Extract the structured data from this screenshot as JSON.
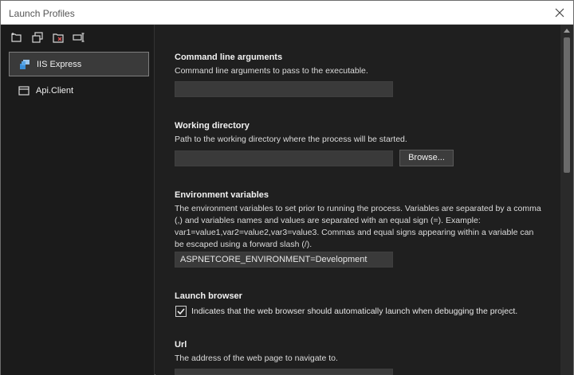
{
  "window": {
    "title": "Launch Profiles"
  },
  "toolbar": {
    "icons": [
      "new-profile-icon",
      "copy-profile-icon",
      "delete-profile-icon",
      "rename-profile-icon"
    ]
  },
  "profiles": [
    {
      "label": "IIS Express",
      "icon": "iis-express-icon",
      "selected": true
    },
    {
      "label": "Api.Client",
      "icon": "project-window-icon",
      "selected": false
    }
  ],
  "command_line": {
    "heading": "Command line arguments",
    "description": "Command line arguments to pass to the executable.",
    "value": ""
  },
  "working_directory": {
    "heading": "Working directory",
    "description": "Path to the working directory where the process will be started.",
    "value": "",
    "browse_label": "Browse..."
  },
  "env_vars": {
    "heading": "Environment variables",
    "description": "The environment variables to set prior to running the process. Variables are separated by a comma (,) and variables names and values are separated with an equal sign (=). Example: var1=value1,var2=value2,var3=value3. Commas and equal signs appearing within a variable can be escaped using a forward slash (/).",
    "value": "ASPNETCORE_ENVIRONMENT=Development"
  },
  "launch_browser": {
    "heading": "Launch browser",
    "checked": true,
    "label": "Indicates that the web browser should automatically launch when debugging the project."
  },
  "url": {
    "heading": "Url",
    "description": "The address of the web page to navigate to."
  }
}
